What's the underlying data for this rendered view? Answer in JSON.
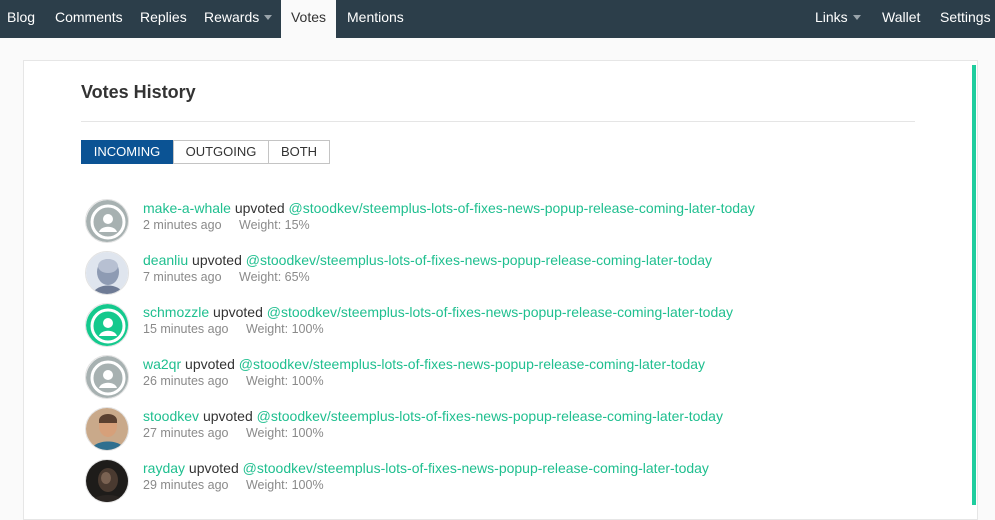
{
  "nav": {
    "left": [
      {
        "label": "Blog"
      },
      {
        "label": "Comments"
      },
      {
        "label": "Replies"
      },
      {
        "label": "Rewards"
      },
      {
        "label": "Votes"
      },
      {
        "label": "Mentions"
      }
    ],
    "right": [
      {
        "label": "Links"
      },
      {
        "label": "Wallet"
      },
      {
        "label": "Settings"
      }
    ],
    "active": "Votes"
  },
  "page": {
    "title": "Votes History"
  },
  "tabs": [
    {
      "label": "INCOMING",
      "active": true
    },
    {
      "label": "OUTGOING",
      "active": false
    },
    {
      "label": "BOTH",
      "active": false
    }
  ],
  "votes": [
    {
      "voter": "make-a-whale",
      "action": "upvoted",
      "post": "@stoodkev/steemplus-lots-of-fixes-news-popup-release-coming-later-today",
      "time": "2 minutes ago",
      "weight": "Weight: 15%",
      "avatar": "default-gray-avatar-icon"
    },
    {
      "voter": "deanliu",
      "action": "upvoted",
      "post": "@stoodkev/steemplus-lots-of-fixes-news-popup-release-coming-later-today",
      "time": "7 minutes ago",
      "weight": "Weight: 65%",
      "avatar": "user-photo"
    },
    {
      "voter": "schmozzle",
      "action": "upvoted",
      "post": "@stoodkev/steemplus-lots-of-fixes-news-popup-release-coming-later-today",
      "time": "15 minutes ago",
      "weight": "Weight: 100%",
      "avatar": "default-green-avatar-icon"
    },
    {
      "voter": "wa2qr",
      "action": "upvoted",
      "post": "@stoodkev/steemplus-lots-of-fixes-news-popup-release-coming-later-today",
      "time": "26 minutes ago",
      "weight": "Weight: 100%",
      "avatar": "default-gray-avatar-icon"
    },
    {
      "voter": "stoodkev",
      "action": "upvoted",
      "post": "@stoodkev/steemplus-lots-of-fixes-news-popup-release-coming-later-today",
      "time": "27 minutes ago",
      "weight": "Weight: 100%",
      "avatar": "user-photo"
    },
    {
      "voter": "rayday",
      "action": "upvoted",
      "post": "@stoodkev/steemplus-lots-of-fixes-news-popup-release-coming-later-today",
      "time": "29 minutes ago",
      "weight": "Weight: 100%",
      "avatar": "user-photo"
    }
  ],
  "colors": {
    "navbar": "#2c3e4a",
    "accent": "#1fcd9e",
    "link": "#1fbf8f",
    "active_tab": "#0b5394"
  }
}
